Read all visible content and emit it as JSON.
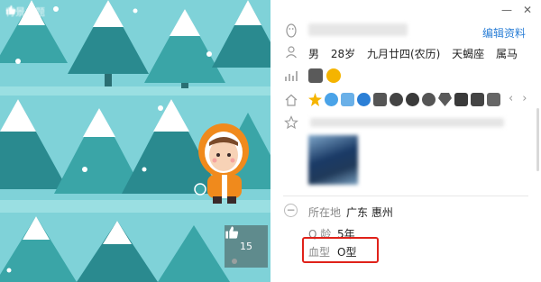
{
  "wallpaper": {
    "top_label": "背景主题",
    "like_count": "15",
    "colors": {
      "sky": "#7fd2d8",
      "tree_dark": "#2a8a8f",
      "tree_mid": "#3aa5a7",
      "snow": "#ffffff",
      "ground": "#8ad8dc",
      "coat": "#f08a1c"
    }
  },
  "header": {
    "edit_label": "编辑资料",
    "minimize_icon": "minimize-icon",
    "close_icon": "close-icon"
  },
  "profile": {
    "gender": "男",
    "age": "28岁",
    "birthday": "九月廿四(农历)",
    "zodiac": "天蝎座",
    "chinese_zodiac": "属马"
  },
  "details": {
    "location_label": "所在地",
    "location_value": "广东 惠州",
    "qage_label": "Q 龄",
    "qage_value": "5年",
    "blood_label": "血型",
    "blood_value": "O型"
  },
  "colors": {
    "accent": "#2b7fd6",
    "highlight": "#e0221a",
    "label": "#888888",
    "text": "#222222"
  }
}
